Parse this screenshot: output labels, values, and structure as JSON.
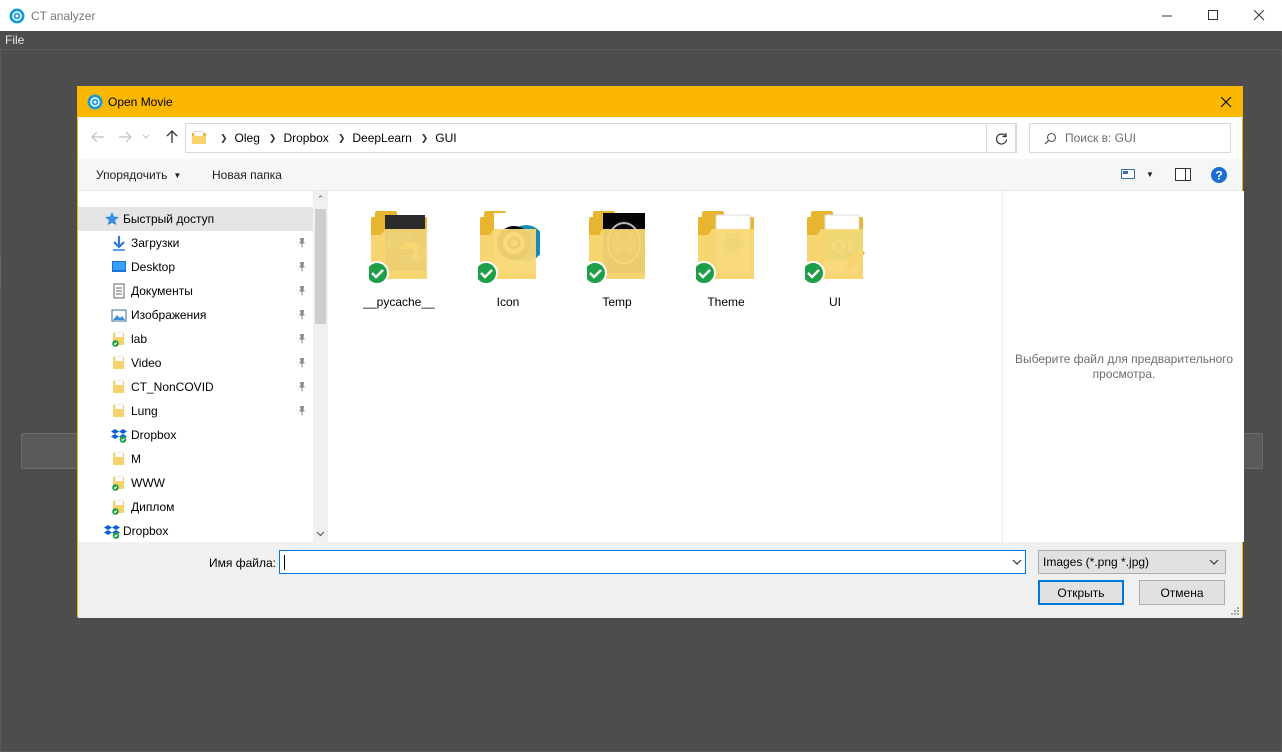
{
  "app": {
    "title": "CT analyzer",
    "menu": [
      "File"
    ]
  },
  "dialog": {
    "title": "Open Movie",
    "breadcrumb": [
      "Oleg",
      "Dropbox",
      "DeepLearn",
      "GUI"
    ],
    "search_placeholder": "Поиск в: GUI",
    "commands": {
      "organize": "Упорядочить",
      "new_folder": "Новая папка"
    },
    "nav_tree": [
      {
        "label": "Быстрый доступ",
        "icon": "star-icon",
        "pinned": false
      },
      {
        "label": "Загрузки",
        "icon": "download-arrow-icon",
        "pinned": true
      },
      {
        "label": "Desktop",
        "icon": "desktop-icon",
        "pinned": true
      },
      {
        "label": "Документы",
        "icon": "documents-icon",
        "pinned": true
      },
      {
        "label": "Изображения",
        "icon": "pictures-icon",
        "pinned": true
      },
      {
        "label": "lab",
        "icon": "synced-folder-icon",
        "pinned": true
      },
      {
        "label": "Video",
        "icon": "folder-icon",
        "pinned": true
      },
      {
        "label": "CT_NonCOVID",
        "icon": "folder-icon",
        "pinned": true
      },
      {
        "label": "Lung",
        "icon": "folder-icon",
        "pinned": true
      },
      {
        "label": "Dropbox",
        "icon": "dropbox-icon",
        "pinned": false
      },
      {
        "label": "M",
        "icon": "folder-icon",
        "pinned": false
      },
      {
        "label": "WWW",
        "icon": "synced-folder-icon",
        "pinned": false
      },
      {
        "label": "Диплом",
        "icon": "synced-folder-icon",
        "pinned": false
      },
      {
        "label": "Dropbox",
        "icon": "dropbox-icon",
        "pinned": false
      }
    ],
    "files": [
      {
        "name": "__pycache__",
        "icon": "python-folder-icon"
      },
      {
        "name": "Icon",
        "icon": "gear-folder-icon"
      },
      {
        "name": "Temp",
        "icon": "ct-scan-folder-icon"
      },
      {
        "name": "Theme",
        "icon": "atom-folder-icon"
      },
      {
        "name": "UI",
        "icon": "qt-folder-icon"
      }
    ],
    "preview_message": "Выберите файл для предварительного просмотра.",
    "filename_label": "Имя файла:",
    "filename_value": "",
    "filter_value": "Images (*.png *.jpg)",
    "open_label": "Открыть",
    "cancel_label": "Отмена"
  },
  "colors": {
    "dialog_title_bg": "#fcb800",
    "app_bg": "#4d4d4d",
    "accent": "#0078d7",
    "synced_badge": "#1e9e47"
  }
}
